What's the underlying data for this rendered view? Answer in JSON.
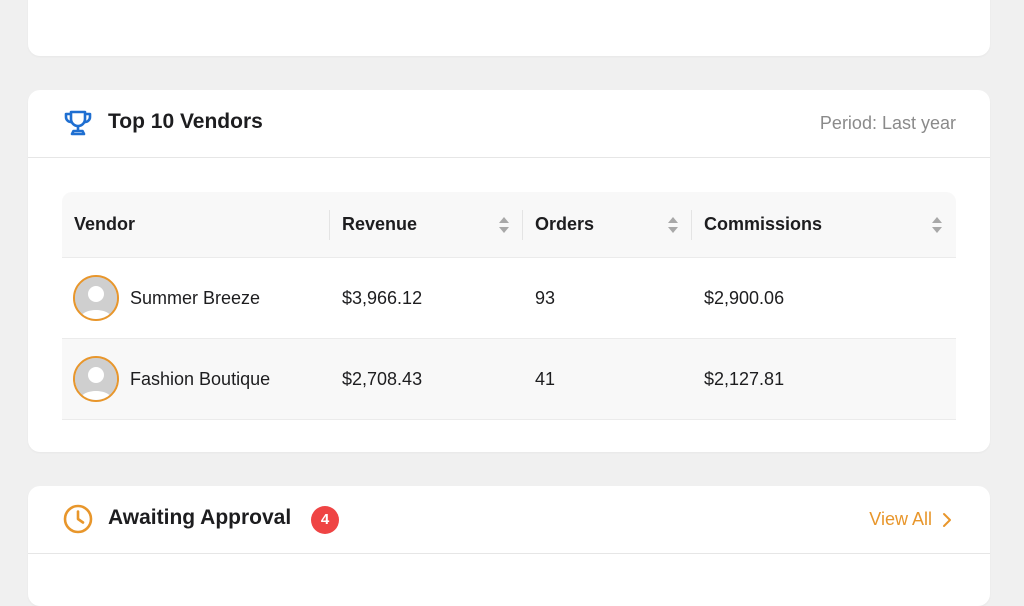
{
  "top_vendors": {
    "title": "Top 10 Vendors",
    "period_label": "Period: Last year",
    "icon": "trophy-icon",
    "accent_color": "#1f6fd1",
    "columns": {
      "vendor": "Vendor",
      "revenue": "Revenue",
      "orders": "Orders",
      "commissions": "Commissions"
    },
    "rows": [
      {
        "name": "Summer Breeze",
        "revenue": "$3,966.12",
        "orders": "93",
        "commissions": "$2,900.06"
      },
      {
        "name": "Fashion Boutique",
        "revenue": "$2,708.43",
        "orders": "41",
        "commissions": "$2,127.81"
      }
    ]
  },
  "awaiting_approval": {
    "title": "Awaiting Approval",
    "count": "4",
    "view_all_label": "View All",
    "icon": "clock-icon",
    "accent_color": "#e8962b",
    "badge_color": "#ef4444"
  }
}
